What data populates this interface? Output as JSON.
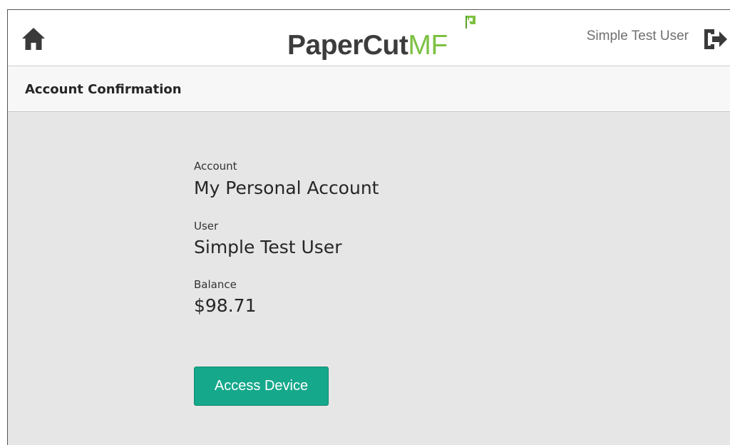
{
  "header": {
    "home_icon": "home-icon",
    "logo_brand": "PaperCut",
    "logo_suffix": "MF",
    "user_name": "Simple Test User",
    "logout_icon": "logout-icon"
  },
  "subheader": {
    "title": "Account Confirmation"
  },
  "details": {
    "account_label": "Account",
    "account_value": "My Personal Account",
    "user_label": "User",
    "user_value": "Simple Test User",
    "balance_label": "Balance",
    "balance_value": "$98.71"
  },
  "actions": {
    "access_device_label": "Access Device"
  },
  "colors": {
    "accent": "#15a88b",
    "logo_green": "#7dc142",
    "background": "#e6e6e6"
  }
}
